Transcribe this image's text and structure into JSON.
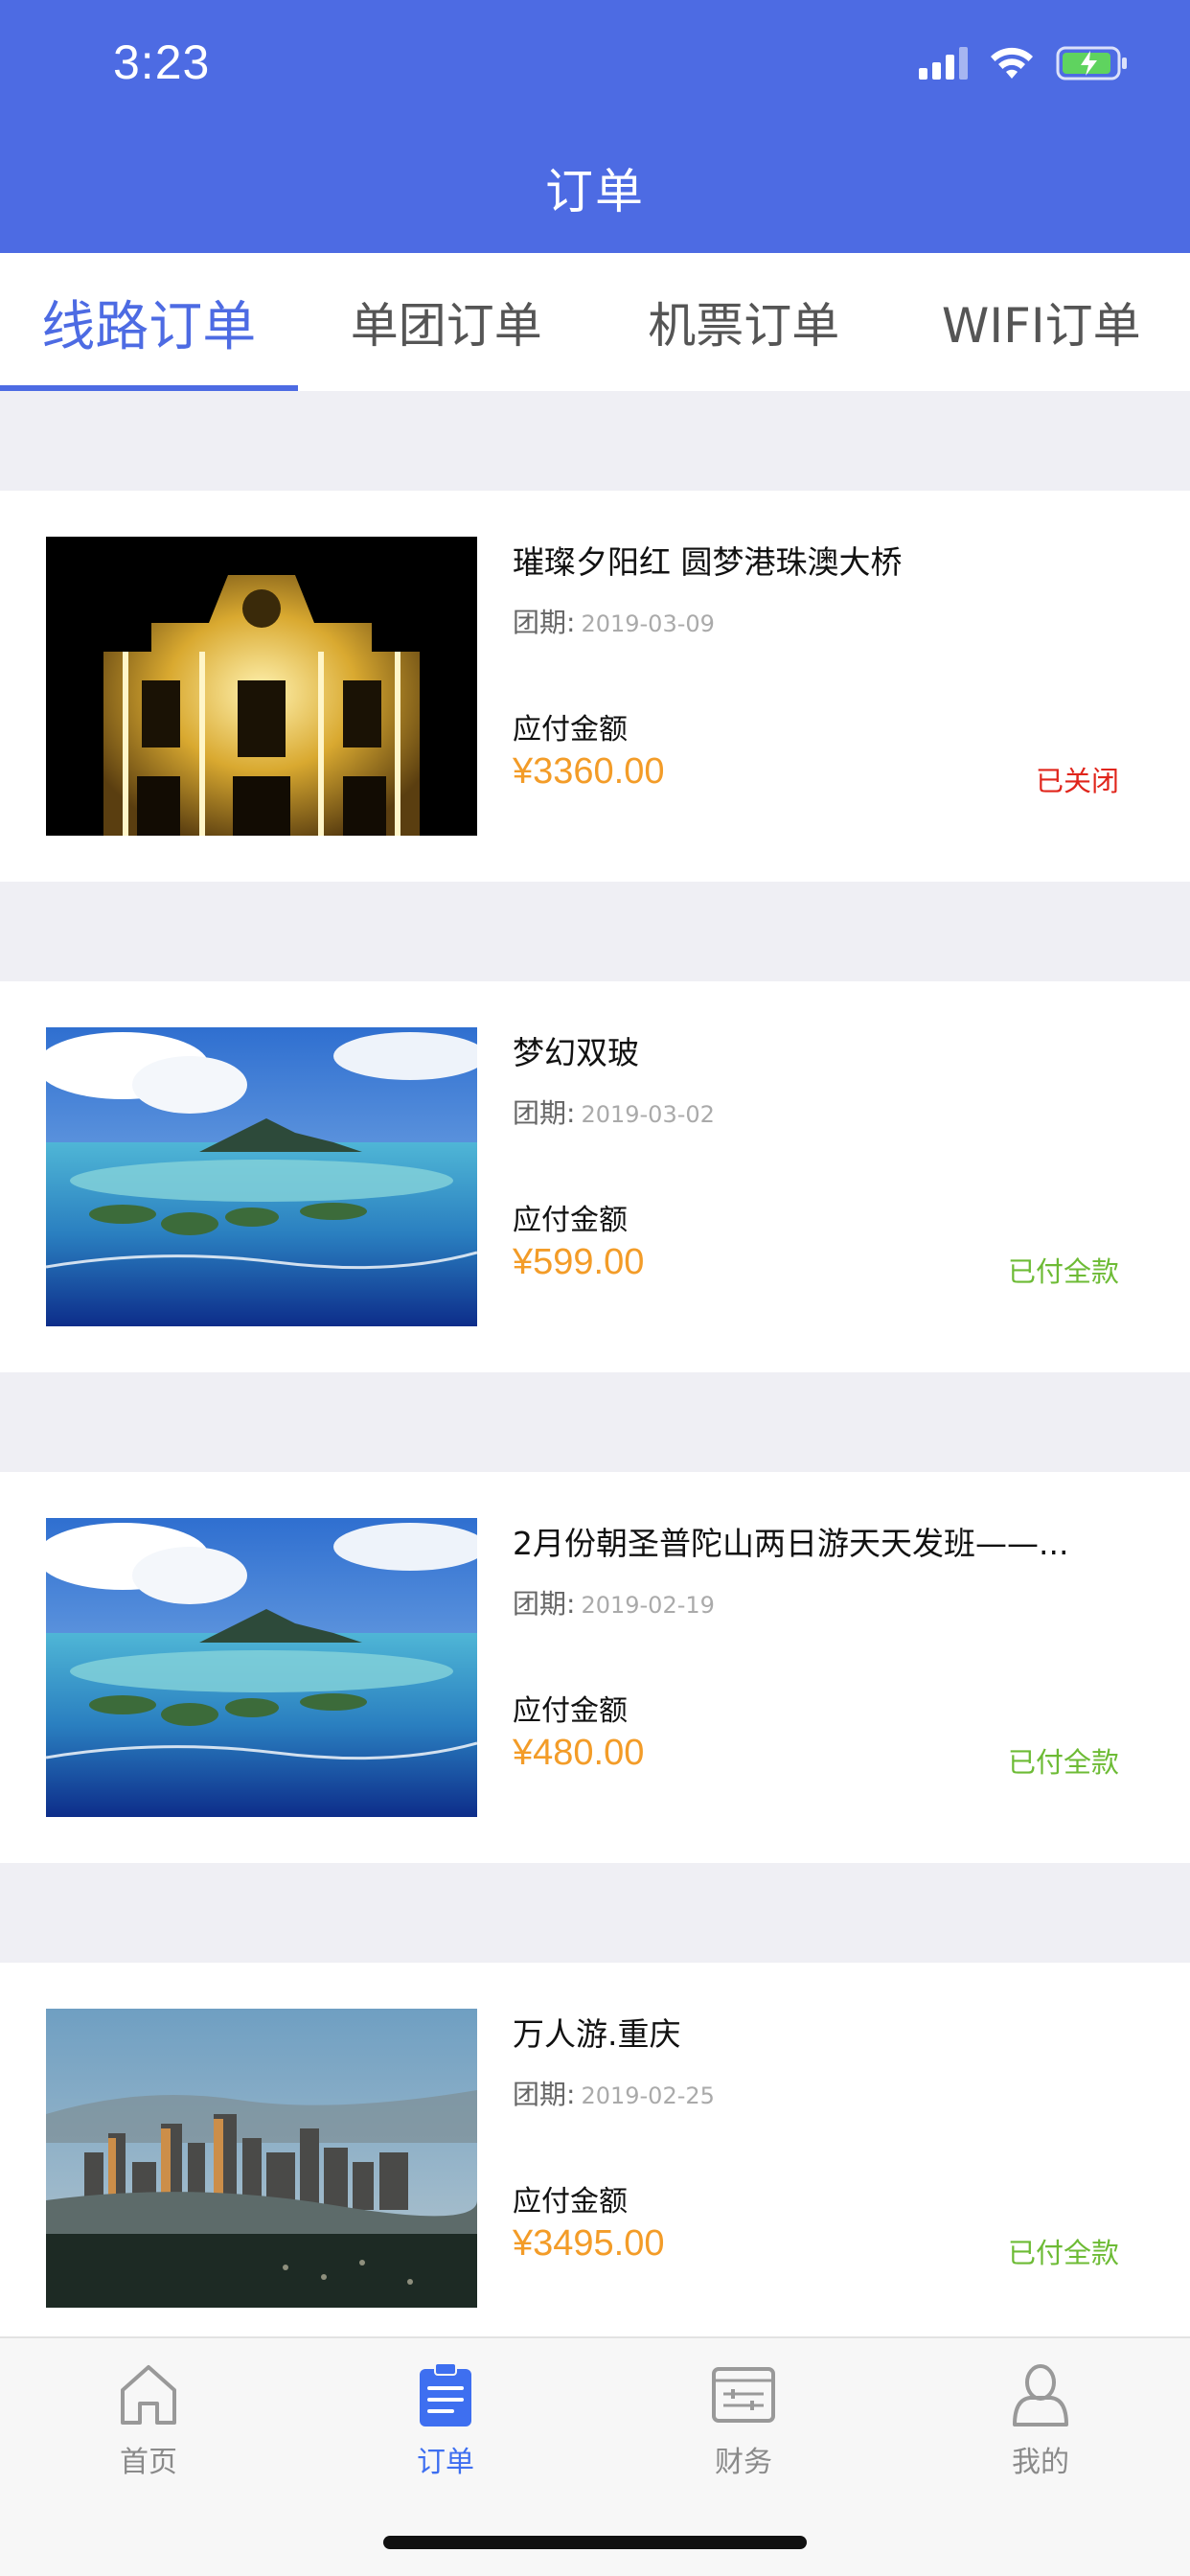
{
  "status_bar": {
    "time": "3:23"
  },
  "header": {
    "title": "订单"
  },
  "tabs": [
    {
      "label": "线路订单",
      "active": true
    },
    {
      "label": "单团订单",
      "active": false
    },
    {
      "label": "机票订单",
      "active": false
    },
    {
      "label": "WIFI订单",
      "active": false
    }
  ],
  "orders": [
    {
      "title": "璀璨夕阳红  圆梦港珠澳大桥",
      "date_label": "团期:",
      "date": "2019-03-09",
      "amount_label": "应付金额",
      "amount": "¥3360.00",
      "status": "已关闭",
      "status_color": "#e0251b",
      "image": "church-night-photo"
    },
    {
      "title": "梦幻双玻",
      "date_label": "团期:",
      "date": "2019-03-02",
      "amount_label": "应付金额",
      "amount": "¥599.00",
      "status": "已付全款",
      "status_color": "#6dbb35",
      "image": "lagoon-island-photo"
    },
    {
      "title": "2月份朝圣普陀山两日游天天发班——...",
      "date_label": "团期:",
      "date": "2019-02-19",
      "amount_label": "应付金额",
      "amount": "¥480.00",
      "status": "已付全款",
      "status_color": "#6dbb35",
      "image": "lagoon-island-photo"
    },
    {
      "title": "万人游.重庆",
      "date_label": "团期:",
      "date": "2019-02-25",
      "amount_label": "应付金额",
      "amount": "¥3495.00",
      "status": "已付全款",
      "status_color": "#6dbb35",
      "image": "chongqing-city-photo"
    }
  ],
  "bottom_nav": [
    {
      "label": "首页",
      "icon": "home-icon",
      "active": false
    },
    {
      "label": "订单",
      "icon": "order-clipboard-icon",
      "active": true
    },
    {
      "label": "财务",
      "icon": "finance-icon",
      "active": false
    },
    {
      "label": "我的",
      "icon": "profile-icon",
      "active": false
    }
  ],
  "colors": {
    "brand": "#4d6be3",
    "amount": "#f39c28",
    "nav_active": "#3e6ff0"
  }
}
